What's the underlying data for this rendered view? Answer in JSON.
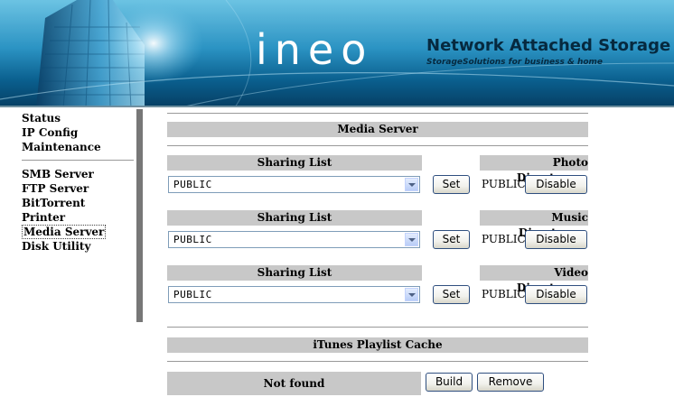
{
  "header": {
    "logo": "ineo",
    "title": "Network Attached Storage",
    "subtitle": "StorageSolutions for business & home"
  },
  "sidebar": {
    "group1": [
      {
        "label": "Status"
      },
      {
        "label": "IP Config"
      },
      {
        "label": "Maintenance"
      }
    ],
    "group2": [
      {
        "label": "SMB Server"
      },
      {
        "label": "FTP Server"
      },
      {
        "label": "BitTorrent"
      },
      {
        "label": "Printer"
      },
      {
        "label": "Media Server",
        "active": true
      },
      {
        "label": "Disk Utility"
      }
    ]
  },
  "main": {
    "section_title": "Media Server",
    "rows": [
      {
        "sharing_label": "Sharing List",
        "selected": "PUBLIC",
        "set_label": "Set",
        "dir_label": "Photo Directory",
        "dir_value": "PUBLIC",
        "disable_label": "Disable"
      },
      {
        "sharing_label": "Sharing List",
        "selected": "PUBLIC",
        "set_label": "Set",
        "dir_label": "Music Directory",
        "dir_value": "PUBLIC",
        "disable_label": "Disable"
      },
      {
        "sharing_label": "Sharing List",
        "selected": "PUBLIC",
        "set_label": "Set",
        "dir_label": "Video Directory",
        "dir_value": "PUBLIC",
        "disable_label": "Disable"
      }
    ],
    "itunes_title": "iTunes Playlist Cache",
    "cache_status": "Not found",
    "build_label": "Build",
    "remove_label": "Remove"
  }
}
